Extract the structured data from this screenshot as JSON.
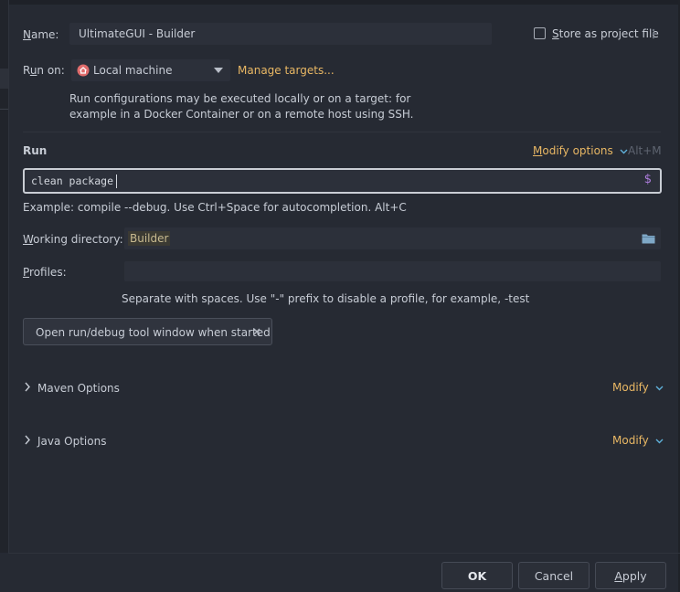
{
  "form": {
    "name_label": "Name:",
    "name_value": "UltimateGUI - Builder",
    "store_label": "Store as project file",
    "store_checked": false,
    "run_on_label": "Run on:",
    "run_on_value": "Local machine",
    "manage_targets": "Manage targets...",
    "run_on_help_1": "Run configurations may be executed locally or on a target: for",
    "run_on_help_2": "example in a Docker Container or on a remote host using SSH.",
    "run_section": "Run",
    "modify_options": "Modify options",
    "modify_options_shortcut": "Alt+M",
    "command_value": "clean package",
    "command_example": "Example: compile --debug. Use Ctrl+Space for autocompletion. Alt+C",
    "workdir_label": "Working directory:",
    "workdir_value": "Builder",
    "profiles_label": "Profiles:",
    "profiles_value": "",
    "profiles_help": "Separate with spaces. Use \"-\" prefix to disable a profile, for example, -test",
    "chip_label": "Open run/debug tool window when started"
  },
  "sections": [
    {
      "label": "Maven Options",
      "action": "Modify"
    },
    {
      "label": "Java Options",
      "action": "Modify"
    }
  ],
  "buttons": {
    "ok": "OK",
    "cancel": "Cancel",
    "apply": "Apply"
  },
  "colors": {
    "background": "#262a33",
    "accent_link": "#e8b764",
    "focus_border": "#c9cdd4",
    "field": "#2c303a"
  }
}
